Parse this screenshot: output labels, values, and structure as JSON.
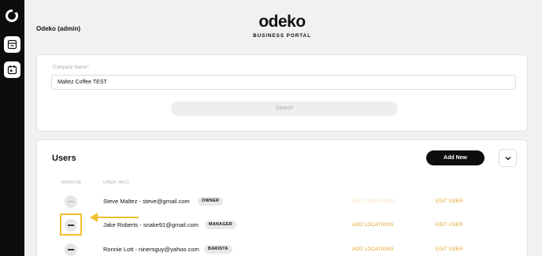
{
  "account": {
    "name": "Odeko (admin)"
  },
  "brand": {
    "logo_text": "odeko",
    "subtitle": "BUSINESS PORTAL"
  },
  "rail": {
    "logo_icon": "odeko-ring-icon",
    "nav_items": [
      {
        "icon": "storefront-icon"
      },
      {
        "icon": "calendar-icon"
      }
    ]
  },
  "company_search": {
    "label": "Company Name",
    "required_marker": "*",
    "value": "Maltez Coffee TEST",
    "search_button": "Search"
  },
  "users": {
    "title": "Users",
    "add_new_label": "Add New",
    "columns": {
      "remove": "REMOVE",
      "info": "USER INFO"
    },
    "rows": [
      {
        "name": "Steve Maltez - steve@gmail.com",
        "role": "OWNER",
        "add_locations": "EDIT LOCATIONS",
        "edit_user": "EDIT USER"
      },
      {
        "name": "Jake Roberts - snake91@gmail.com",
        "role": "MANAGER",
        "add_locations": "ADD LOCATIONS",
        "edit_user": "EDIT USER"
      },
      {
        "name": "Ronnie Lott - ninersguy@yahoo.com",
        "role": "BARISTA",
        "add_locations": "ADD LOCATIONS",
        "edit_user": "EDIT USER"
      }
    ]
  },
  "colors": {
    "accent": "#e0a220",
    "highlight": "#f3c030",
    "rail": "#0d0d0d"
  }
}
